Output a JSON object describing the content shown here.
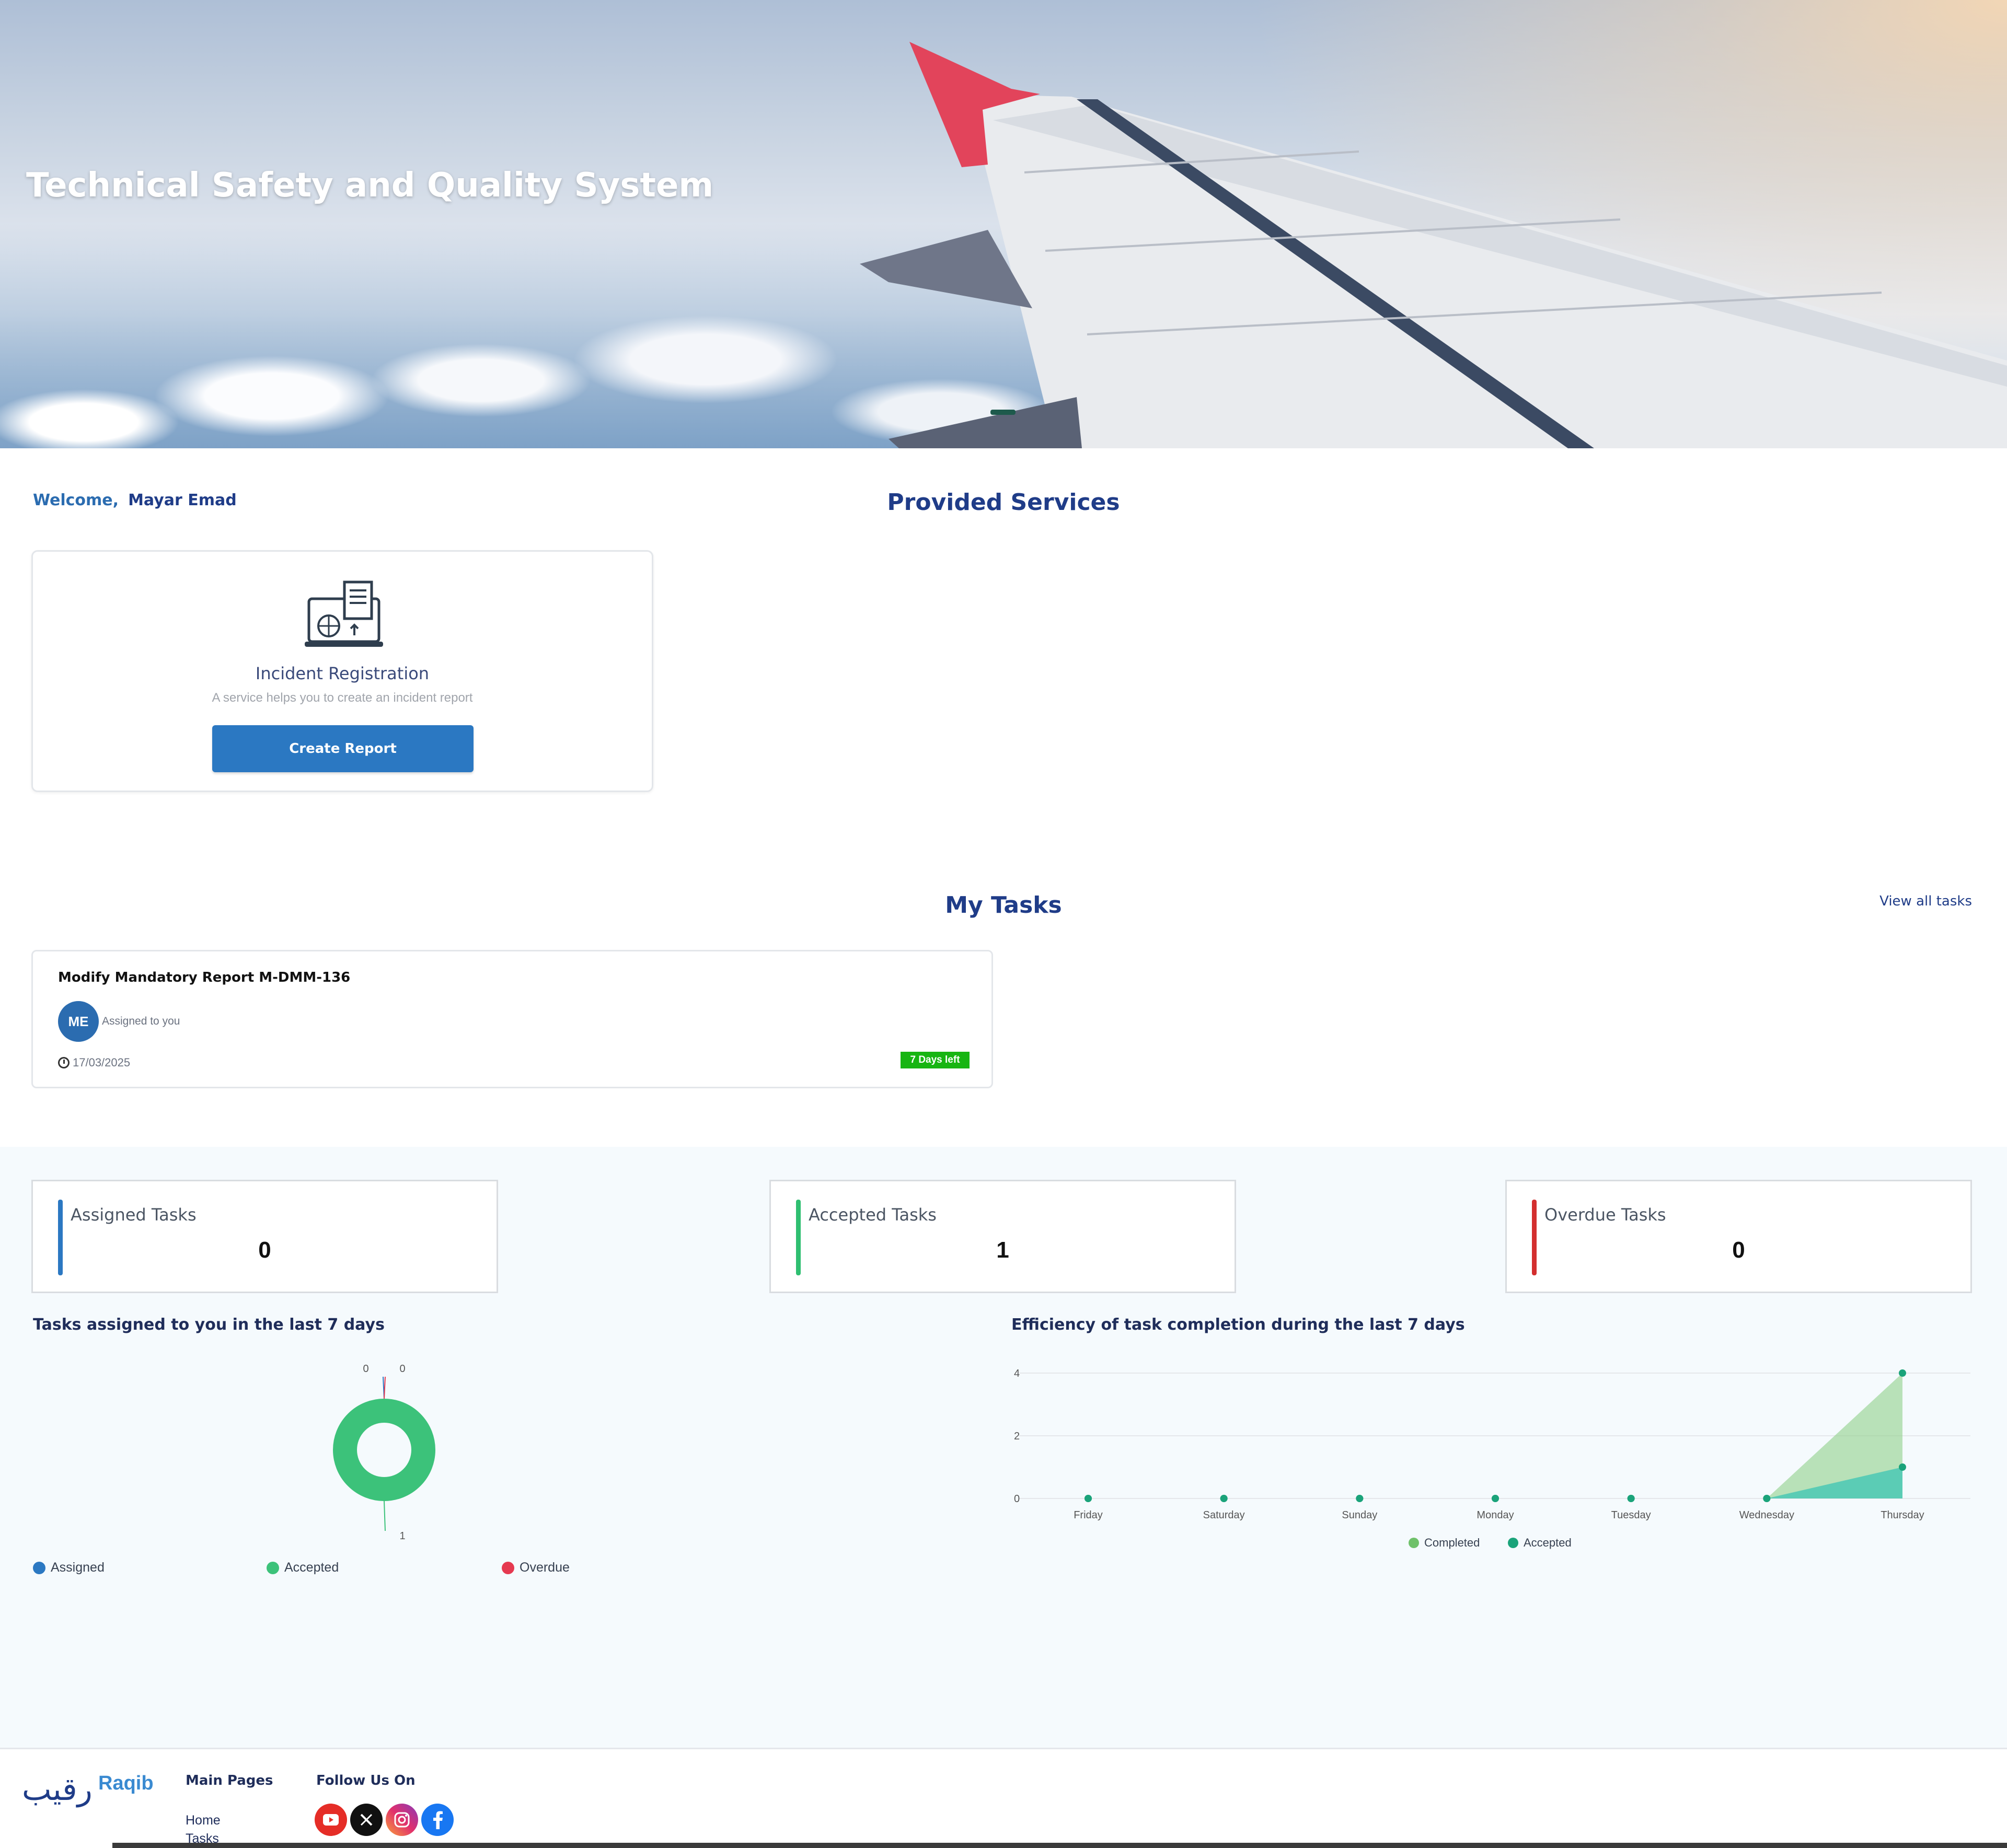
{
  "hero": {
    "title": "Technical Safety and Quality System"
  },
  "welcome": {
    "greeting": "Welcome,",
    "user_name": "Mayar Emad"
  },
  "services": {
    "section_title": "Provided Services",
    "items": [
      {
        "icon": "laptop-report-icon",
        "name": "Incident Registration",
        "description": "A service  helps you to create an incident report",
        "button_label": "Create Report"
      }
    ]
  },
  "tasks": {
    "section_title": "My Tasks",
    "view_all_label": "View all tasks",
    "items": [
      {
        "title": "Modify Mandatory Report M-DMM-136",
        "avatar_initials": "ME",
        "assigned_label": "Assigned to you",
        "date": "17/03/2025",
        "badge": "7 Days left",
        "badge_color": "#17b512"
      }
    ]
  },
  "stats": [
    {
      "label": "Assigned Tasks",
      "value": "0",
      "color": "#2b78c2"
    },
    {
      "label": "Accepted Tasks",
      "value": "1",
      "color": "#2fbf71"
    },
    {
      "label": "Overdue Tasks",
      "value": "0",
      "color": "#d32f2f"
    }
  ],
  "chart_data": [
    {
      "type": "pie",
      "title": "Tasks assigned to you in the last 7 days",
      "categories": [
        "Assigned",
        "Accepted",
        "Overdue"
      ],
      "values": [
        0,
        1,
        0
      ],
      "colors": [
        "#2b78c2",
        "#3cc27a",
        "#e53950"
      ],
      "legend": "bottom",
      "donut": true
    },
    {
      "type": "area",
      "title": "Efficiency of task completion during the last 7 days",
      "categories": [
        "Friday",
        "Saturday",
        "Sunday",
        "Monday",
        "Tuesday",
        "Wednesday",
        "Thursday"
      ],
      "series": [
        {
          "name": "Completed",
          "values": [
            0,
            0,
            0,
            0,
            0,
            0,
            4
          ],
          "color": "#8fd18a"
        },
        {
          "name": "Accepted",
          "values": [
            0,
            0,
            0,
            0,
            0,
            0,
            1
          ],
          "color": "#3cc4b4"
        }
      ],
      "ylim": [
        0,
        4
      ],
      "yticks": [
        0,
        2,
        4
      ],
      "grid": true,
      "legend": "bottom"
    }
  ],
  "footer": {
    "logo_ar": "رقيب",
    "logo_en": "Raqib",
    "main_pages_title": "Main Pages",
    "links": [
      "Home",
      "Tasks"
    ],
    "follow_title": "Follow Us On",
    "social": [
      {
        "icon": "youtube-icon",
        "color": "#e52d27"
      },
      {
        "icon": "x-icon",
        "color": "#111111"
      },
      {
        "icon": "instagram-icon",
        "color": "#c13584"
      },
      {
        "icon": "facebook-icon",
        "color": "#1877f2"
      }
    ]
  }
}
